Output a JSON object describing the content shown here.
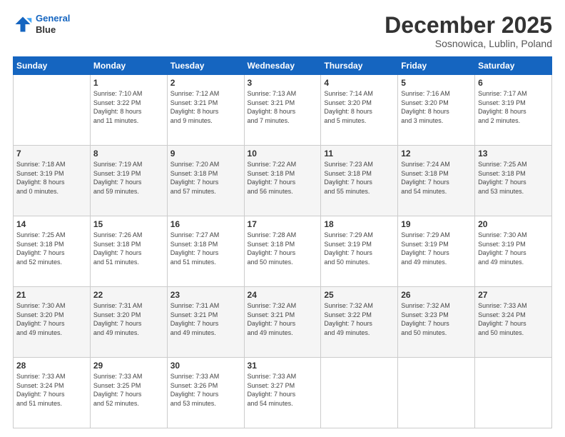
{
  "header": {
    "logo_line1": "General",
    "logo_line2": "Blue",
    "month": "December 2025",
    "location": "Sosnowica, Lublin, Poland"
  },
  "days_of_week": [
    "Sunday",
    "Monday",
    "Tuesday",
    "Wednesday",
    "Thursday",
    "Friday",
    "Saturday"
  ],
  "weeks": [
    [
      {
        "day": "",
        "info": ""
      },
      {
        "day": "1",
        "info": "Sunrise: 7:10 AM\nSunset: 3:22 PM\nDaylight: 8 hours\nand 11 minutes."
      },
      {
        "day": "2",
        "info": "Sunrise: 7:12 AM\nSunset: 3:21 PM\nDaylight: 8 hours\nand 9 minutes."
      },
      {
        "day": "3",
        "info": "Sunrise: 7:13 AM\nSunset: 3:21 PM\nDaylight: 8 hours\nand 7 minutes."
      },
      {
        "day": "4",
        "info": "Sunrise: 7:14 AM\nSunset: 3:20 PM\nDaylight: 8 hours\nand 5 minutes."
      },
      {
        "day": "5",
        "info": "Sunrise: 7:16 AM\nSunset: 3:20 PM\nDaylight: 8 hours\nand 3 minutes."
      },
      {
        "day": "6",
        "info": "Sunrise: 7:17 AM\nSunset: 3:19 PM\nDaylight: 8 hours\nand 2 minutes."
      }
    ],
    [
      {
        "day": "7",
        "info": "Sunrise: 7:18 AM\nSunset: 3:19 PM\nDaylight: 8 hours\nand 0 minutes."
      },
      {
        "day": "8",
        "info": "Sunrise: 7:19 AM\nSunset: 3:19 PM\nDaylight: 7 hours\nand 59 minutes."
      },
      {
        "day": "9",
        "info": "Sunrise: 7:20 AM\nSunset: 3:18 PM\nDaylight: 7 hours\nand 57 minutes."
      },
      {
        "day": "10",
        "info": "Sunrise: 7:22 AM\nSunset: 3:18 PM\nDaylight: 7 hours\nand 56 minutes."
      },
      {
        "day": "11",
        "info": "Sunrise: 7:23 AM\nSunset: 3:18 PM\nDaylight: 7 hours\nand 55 minutes."
      },
      {
        "day": "12",
        "info": "Sunrise: 7:24 AM\nSunset: 3:18 PM\nDaylight: 7 hours\nand 54 minutes."
      },
      {
        "day": "13",
        "info": "Sunrise: 7:25 AM\nSunset: 3:18 PM\nDaylight: 7 hours\nand 53 minutes."
      }
    ],
    [
      {
        "day": "14",
        "info": "Sunrise: 7:25 AM\nSunset: 3:18 PM\nDaylight: 7 hours\nand 52 minutes."
      },
      {
        "day": "15",
        "info": "Sunrise: 7:26 AM\nSunset: 3:18 PM\nDaylight: 7 hours\nand 51 minutes."
      },
      {
        "day": "16",
        "info": "Sunrise: 7:27 AM\nSunset: 3:18 PM\nDaylight: 7 hours\nand 51 minutes."
      },
      {
        "day": "17",
        "info": "Sunrise: 7:28 AM\nSunset: 3:18 PM\nDaylight: 7 hours\nand 50 minutes."
      },
      {
        "day": "18",
        "info": "Sunrise: 7:29 AM\nSunset: 3:19 PM\nDaylight: 7 hours\nand 50 minutes."
      },
      {
        "day": "19",
        "info": "Sunrise: 7:29 AM\nSunset: 3:19 PM\nDaylight: 7 hours\nand 49 minutes."
      },
      {
        "day": "20",
        "info": "Sunrise: 7:30 AM\nSunset: 3:19 PM\nDaylight: 7 hours\nand 49 minutes."
      }
    ],
    [
      {
        "day": "21",
        "info": "Sunrise: 7:30 AM\nSunset: 3:20 PM\nDaylight: 7 hours\nand 49 minutes."
      },
      {
        "day": "22",
        "info": "Sunrise: 7:31 AM\nSunset: 3:20 PM\nDaylight: 7 hours\nand 49 minutes."
      },
      {
        "day": "23",
        "info": "Sunrise: 7:31 AM\nSunset: 3:21 PM\nDaylight: 7 hours\nand 49 minutes."
      },
      {
        "day": "24",
        "info": "Sunrise: 7:32 AM\nSunset: 3:21 PM\nDaylight: 7 hours\nand 49 minutes."
      },
      {
        "day": "25",
        "info": "Sunrise: 7:32 AM\nSunset: 3:22 PM\nDaylight: 7 hours\nand 49 minutes."
      },
      {
        "day": "26",
        "info": "Sunrise: 7:32 AM\nSunset: 3:23 PM\nDaylight: 7 hours\nand 50 minutes."
      },
      {
        "day": "27",
        "info": "Sunrise: 7:33 AM\nSunset: 3:24 PM\nDaylight: 7 hours\nand 50 minutes."
      }
    ],
    [
      {
        "day": "28",
        "info": "Sunrise: 7:33 AM\nSunset: 3:24 PM\nDaylight: 7 hours\nand 51 minutes."
      },
      {
        "day": "29",
        "info": "Sunrise: 7:33 AM\nSunset: 3:25 PM\nDaylight: 7 hours\nand 52 minutes."
      },
      {
        "day": "30",
        "info": "Sunrise: 7:33 AM\nSunset: 3:26 PM\nDaylight: 7 hours\nand 53 minutes."
      },
      {
        "day": "31",
        "info": "Sunrise: 7:33 AM\nSunset: 3:27 PM\nDaylight: 7 hours\nand 54 minutes."
      },
      {
        "day": "",
        "info": ""
      },
      {
        "day": "",
        "info": ""
      },
      {
        "day": "",
        "info": ""
      }
    ]
  ]
}
